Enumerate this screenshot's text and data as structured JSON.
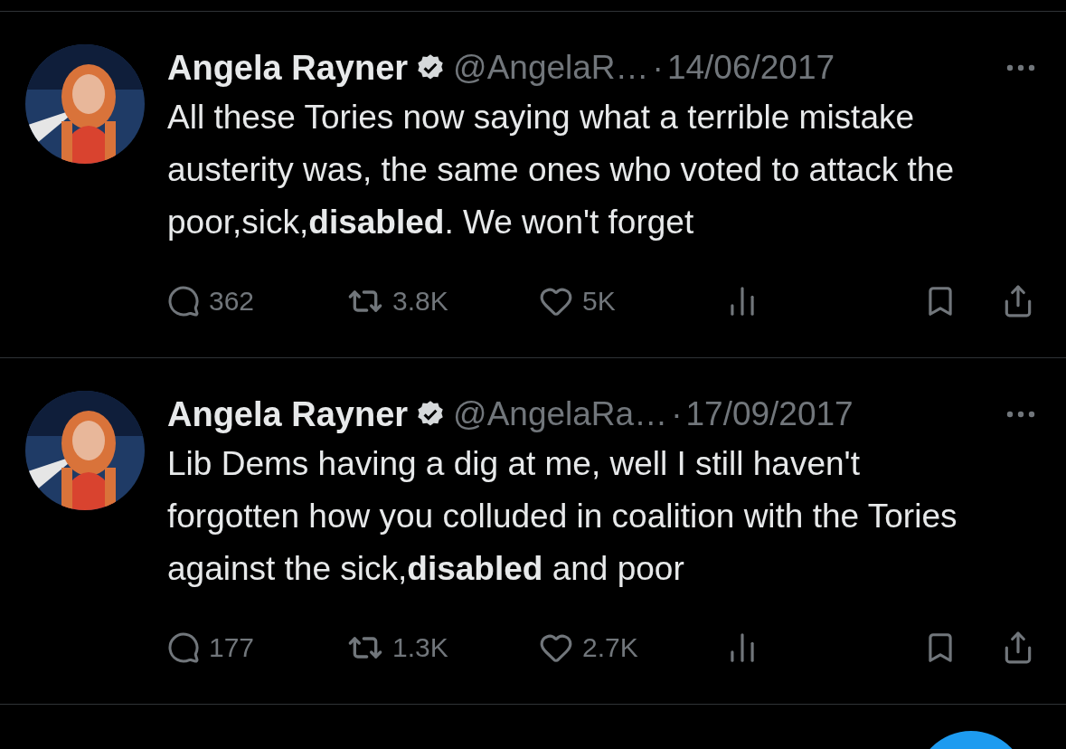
{
  "tweets": [
    {
      "name": "Angela Rayner",
      "verified": true,
      "handle": "@AngelaR…",
      "dot": "·",
      "date": "14/06/2017",
      "text": "All these Tories now saying what a terrible mistake austerity was, the same ones who voted to attack the poor,sick,**disabled**. We won't forget",
      "replies": "362",
      "retweets": "3.8K",
      "likes": "5K"
    },
    {
      "name": "Angela Rayner",
      "verified": true,
      "handle": "@AngelaRa…",
      "dot": "·",
      "date": "17/09/2017",
      "text": "Lib Dems having a dig at me, well I still haven't forgotten how you colluded in coalition with the Tories against the sick,**disabled** and poor",
      "replies": "177",
      "retweets": "1.3K",
      "likes": "2.7K"
    }
  ]
}
